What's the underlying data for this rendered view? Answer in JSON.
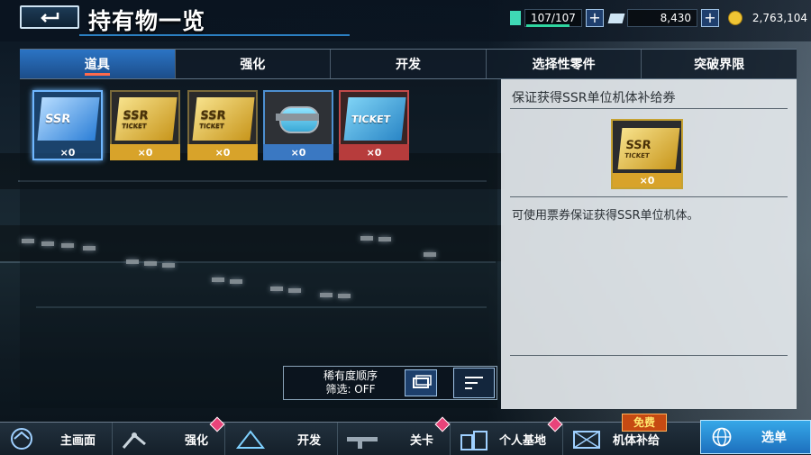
{
  "header": {
    "title": "持有物一览",
    "stamina": "107/107",
    "currency_gem": "8,430",
    "currency_coin": "2,763,104"
  },
  "tabs": [
    {
      "label": "道具",
      "active": true
    },
    {
      "label": "强化",
      "active": false
    },
    {
      "label": "开发",
      "active": false
    },
    {
      "label": "选择性零件",
      "active": false
    },
    {
      "label": "突破界限",
      "active": false
    }
  ],
  "items": [
    {
      "card_text": "SSR",
      "qty": "×0",
      "rarity": "blue",
      "selected": true
    },
    {
      "card_text": "SSR",
      "card_sub": "TICKET",
      "qty": "×0",
      "rarity": "gold"
    },
    {
      "card_text": "SSR",
      "card_sub": "TICKET",
      "qty": "×0",
      "rarity": "gold"
    },
    {
      "card_text": "",
      "qty": "×0",
      "rarity": "blue-device"
    },
    {
      "card_text": "TICKET",
      "qty": "×0",
      "rarity": "red"
    }
  ],
  "sort": {
    "order_label": "稀有度顺序",
    "filter_label": "筛选: OFF"
  },
  "detail": {
    "name": "保证获得SSR单位机体补给券",
    "card_text": "SSR",
    "card_sub": "TICKET",
    "qty": "×0",
    "description": "可使用票券保证获得SSR单位机体。"
  },
  "nav": [
    {
      "label": "主画面",
      "icon": "home-icon"
    },
    {
      "label": "强化",
      "icon": "wrench-arm-icon"
    },
    {
      "label": "开发",
      "icon": "develop-icon"
    },
    {
      "label": "关卡",
      "icon": "rifle-icon"
    },
    {
      "label": "个人基地",
      "icon": "base-icon"
    },
    {
      "label": "机体补给",
      "icon": "supply-icon"
    }
  ],
  "nav_menu_label": "选单",
  "free_badge": "免费",
  "colors": {
    "accent_blue": "#2b74c4",
    "gold": "#e0b52c",
    "red_badge": "#e8447a",
    "panel_light": "#e8ecf0"
  }
}
